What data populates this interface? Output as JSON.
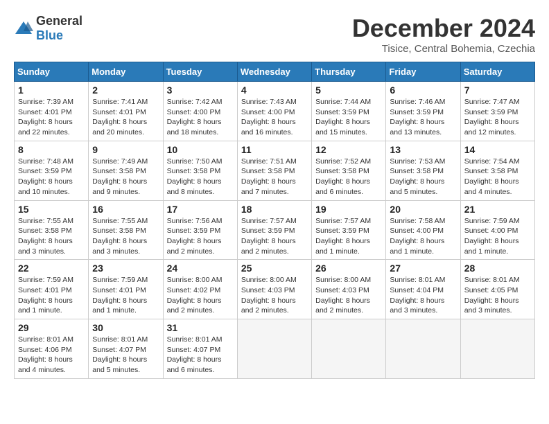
{
  "header": {
    "logo_general": "General",
    "logo_blue": "Blue",
    "month_title": "December 2024",
    "subtitle": "Tisice, Central Bohemia, Czechia"
  },
  "calendar": {
    "days_of_week": [
      "Sunday",
      "Monday",
      "Tuesday",
      "Wednesday",
      "Thursday",
      "Friday",
      "Saturday"
    ],
    "weeks": [
      [
        {
          "day": "",
          "content": ""
        },
        {
          "day": "2",
          "content": "Sunrise: 7:41 AM\nSunset: 4:01 PM\nDaylight: 8 hours\nand 20 minutes."
        },
        {
          "day": "3",
          "content": "Sunrise: 7:42 AM\nSunset: 4:00 PM\nDaylight: 8 hours\nand 18 minutes."
        },
        {
          "day": "4",
          "content": "Sunrise: 7:43 AM\nSunset: 4:00 PM\nDaylight: 8 hours\nand 16 minutes."
        },
        {
          "day": "5",
          "content": "Sunrise: 7:44 AM\nSunset: 3:59 PM\nDaylight: 8 hours\nand 15 minutes."
        },
        {
          "day": "6",
          "content": "Sunrise: 7:46 AM\nSunset: 3:59 PM\nDaylight: 8 hours\nand 13 minutes."
        },
        {
          "day": "7",
          "content": "Sunrise: 7:47 AM\nSunset: 3:59 PM\nDaylight: 8 hours\nand 12 minutes."
        }
      ],
      [
        {
          "day": "8",
          "content": "Sunrise: 7:48 AM\nSunset: 3:59 PM\nDaylight: 8 hours\nand 10 minutes."
        },
        {
          "day": "9",
          "content": "Sunrise: 7:49 AM\nSunset: 3:58 PM\nDaylight: 8 hours\nand 9 minutes."
        },
        {
          "day": "10",
          "content": "Sunrise: 7:50 AM\nSunset: 3:58 PM\nDaylight: 8 hours\nand 8 minutes."
        },
        {
          "day": "11",
          "content": "Sunrise: 7:51 AM\nSunset: 3:58 PM\nDaylight: 8 hours\nand 7 minutes."
        },
        {
          "day": "12",
          "content": "Sunrise: 7:52 AM\nSunset: 3:58 PM\nDaylight: 8 hours\nand 6 minutes."
        },
        {
          "day": "13",
          "content": "Sunrise: 7:53 AM\nSunset: 3:58 PM\nDaylight: 8 hours\nand 5 minutes."
        },
        {
          "day": "14",
          "content": "Sunrise: 7:54 AM\nSunset: 3:58 PM\nDaylight: 8 hours\nand 4 minutes."
        }
      ],
      [
        {
          "day": "15",
          "content": "Sunrise: 7:55 AM\nSunset: 3:58 PM\nDaylight: 8 hours\nand 3 minutes."
        },
        {
          "day": "16",
          "content": "Sunrise: 7:55 AM\nSunset: 3:58 PM\nDaylight: 8 hours\nand 3 minutes."
        },
        {
          "day": "17",
          "content": "Sunrise: 7:56 AM\nSunset: 3:59 PM\nDaylight: 8 hours\nand 2 minutes."
        },
        {
          "day": "18",
          "content": "Sunrise: 7:57 AM\nSunset: 3:59 PM\nDaylight: 8 hours\nand 2 minutes."
        },
        {
          "day": "19",
          "content": "Sunrise: 7:57 AM\nSunset: 3:59 PM\nDaylight: 8 hours\nand 1 minute."
        },
        {
          "day": "20",
          "content": "Sunrise: 7:58 AM\nSunset: 4:00 PM\nDaylight: 8 hours\nand 1 minute."
        },
        {
          "day": "21",
          "content": "Sunrise: 7:59 AM\nSunset: 4:00 PM\nDaylight: 8 hours\nand 1 minute."
        }
      ],
      [
        {
          "day": "22",
          "content": "Sunrise: 7:59 AM\nSunset: 4:01 PM\nDaylight: 8 hours\nand 1 minute."
        },
        {
          "day": "23",
          "content": "Sunrise: 7:59 AM\nSunset: 4:01 PM\nDaylight: 8 hours\nand 1 minute."
        },
        {
          "day": "24",
          "content": "Sunrise: 8:00 AM\nSunset: 4:02 PM\nDaylight: 8 hours\nand 2 minutes."
        },
        {
          "day": "25",
          "content": "Sunrise: 8:00 AM\nSunset: 4:03 PM\nDaylight: 8 hours\nand 2 minutes."
        },
        {
          "day": "26",
          "content": "Sunrise: 8:00 AM\nSunset: 4:03 PM\nDaylight: 8 hours\nand 2 minutes."
        },
        {
          "day": "27",
          "content": "Sunrise: 8:01 AM\nSunset: 4:04 PM\nDaylight: 8 hours\nand 3 minutes."
        },
        {
          "day": "28",
          "content": "Sunrise: 8:01 AM\nSunset: 4:05 PM\nDaylight: 8 hours\nand 3 minutes."
        }
      ],
      [
        {
          "day": "29",
          "content": "Sunrise: 8:01 AM\nSunset: 4:06 PM\nDaylight: 8 hours\nand 4 minutes."
        },
        {
          "day": "30",
          "content": "Sunrise: 8:01 AM\nSunset: 4:07 PM\nDaylight: 8 hours\nand 5 minutes."
        },
        {
          "day": "31",
          "content": "Sunrise: 8:01 AM\nSunset: 4:07 PM\nDaylight: 8 hours\nand 6 minutes."
        },
        {
          "day": "",
          "content": ""
        },
        {
          "day": "",
          "content": ""
        },
        {
          "day": "",
          "content": ""
        },
        {
          "day": "",
          "content": ""
        }
      ]
    ],
    "week1_day1": {
      "day": "1",
      "content": "Sunrise: 7:39 AM\nSunset: 4:01 PM\nDaylight: 8 hours\nand 22 minutes."
    }
  }
}
